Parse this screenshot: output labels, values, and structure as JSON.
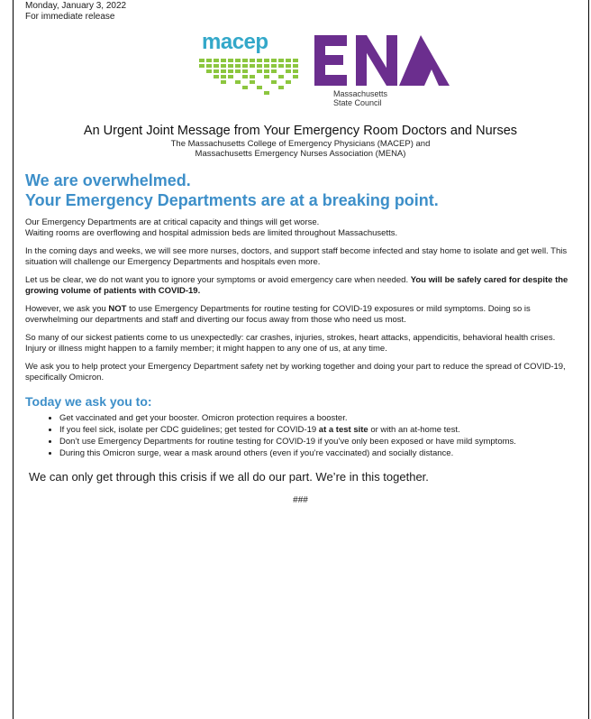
{
  "header": {
    "date": "Monday, January 3, 2022",
    "release": "For immediate release"
  },
  "logos": {
    "macep_word": "macep",
    "ena_caption_line1": "Massachusetts",
    "ena_caption_line2": "State Council",
    "macep_color": "#33a8c9",
    "macep_grid_color": "#8cc63f",
    "ena_color": "#6b2e8e"
  },
  "title": {
    "headline": "An Urgent Joint Message from Your Emergency Room Doctors and Nurses",
    "sub_line1": "The Massachusetts College of Emergency Physicians (MACEP) and",
    "sub_line2": "Massachusetts Emergency Nurses Association (MENA)"
  },
  "banner": {
    "line1": "We are overwhelmed.",
    "line2": "Your Emergency Departments are at a breaking point.",
    "color": "#3d8fc9"
  },
  "body": {
    "p1_line1": "Our Emergency Departments are at critical capacity and things will get worse.",
    "p1_line2": "Waiting rooms are overflowing and hospital admission beds are limited throughout Massachusetts.",
    "p2": "In the coming days and weeks, we will see more nurses, doctors, and support staff become infected and stay home to isolate and get well. This situation will challenge our Emergency Departments and hospitals even more.",
    "p3_a": "Let us be clear, we do not want you to ignore your symptoms or avoid emergency care when needed. ",
    "p3_bold": "You will be safely cared for despite the growing volume of patients with COVID-19",
    "p3_end": ".",
    "p4_a": "However, we ask you ",
    "p4_bold": "NOT",
    "p4_b": " to use Emergency Departments for routine testing for COVID-19 exposures or mild symptoms. Doing so is overwhelming our departments and staff and diverting our focus away from those who need us most.",
    "p5": "So many of our sickest patients come to us unexpectedly: car crashes, injuries, strokes, heart attacks, appendicitis, behavioral health crises. Injury or illness might happen to a family member; it might happen to any one of us, at any time.",
    "p6": "We ask you to help protect your Emergency Department safety net by working together and doing your part to reduce the spread of COVID-19, specifically Omicron."
  },
  "asks": {
    "title": "Today we ask you to:",
    "item1": "Get vaccinated and get your booster. Omicron protection requires a booster.",
    "item2_a": "If you feel sick, isolate per CDC guidelines; get tested for COVID-19 ",
    "item2_bold": "at a test site",
    "item2_b": " or with an at-home test.",
    "item3": "Don’t use Emergency Departments for routine testing for COVID-19 if you’ve only been exposed or have mild symptoms.",
    "item4": "During this Omicron surge, wear a mask around others (even if you’re vaccinated) and socially distance."
  },
  "closing": {
    "text": "We can only get through this crisis if we all do our part. We’re in this together.",
    "end_mark": "###"
  }
}
